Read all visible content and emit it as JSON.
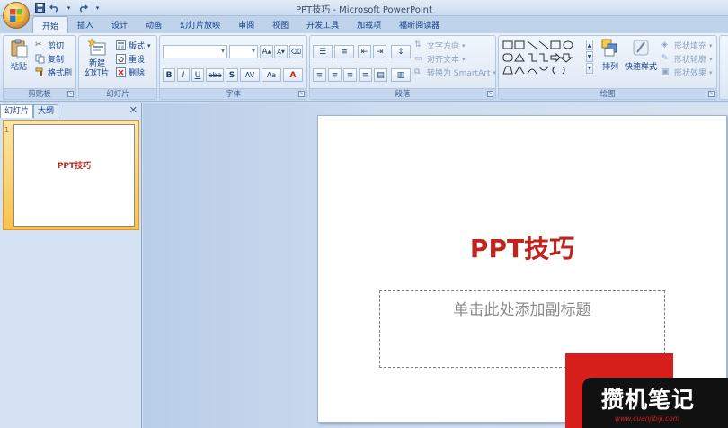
{
  "window": {
    "title": "PPT技巧 - Microsoft PowerPoint"
  },
  "qat": {
    "save_icon": "save-icon",
    "undo_icon": "undo-icon",
    "redo_icon": "redo-icon",
    "customize_icon": "chevron-down-icon"
  },
  "tabs": [
    "开始",
    "插入",
    "设计",
    "动画",
    "幻灯片放映",
    "审阅",
    "视图",
    "开发工具",
    "加载项",
    "福昕阅读器"
  ],
  "ribbon": {
    "clipboard": {
      "label": "剪贴板",
      "paste": "粘贴",
      "cut": "剪切",
      "copy": "复制",
      "format_painter": "格式刷"
    },
    "slides": {
      "label": "幻灯片",
      "new_slide_1": "新建",
      "new_slide_2": "幻灯片",
      "layout": "版式",
      "reset": "重设",
      "delete": "删除"
    },
    "font": {
      "label": "字体",
      "font_name": "",
      "font_size": "",
      "bold": "B",
      "italic": "I",
      "underline": "U",
      "strike": "abe",
      "shadow": "S",
      "spacing": "AV",
      "case": "Aa",
      "grow": "A",
      "shrink": "A"
    },
    "paragraph": {
      "label": "段落",
      "text_direction": "文字方向",
      "align_text": "对齐文本",
      "smartart": "转换为 SmartArt"
    },
    "drawing": {
      "label": "绘图",
      "arrange": "排列",
      "quick_styles": "快速样式",
      "shape_fill": "形状填充",
      "shape_outline": "形状轮廓",
      "shape_effects": "形状效果"
    }
  },
  "pane": {
    "tab_slides": "幻灯片",
    "tab_outline": "大纲",
    "slide_number": "1",
    "thumb_title": "PPT技巧"
  },
  "slide": {
    "title": "PPT技巧",
    "subtitle_placeholder": "单击此处添加副标题"
  },
  "watermark": {
    "text": "攒机笔记",
    "url": "www.cuanjibiji.com"
  },
  "colors": {
    "title_red": "#c0241c",
    "ribbon_blue": "#15428b",
    "watermark_red": "#d7201b"
  }
}
